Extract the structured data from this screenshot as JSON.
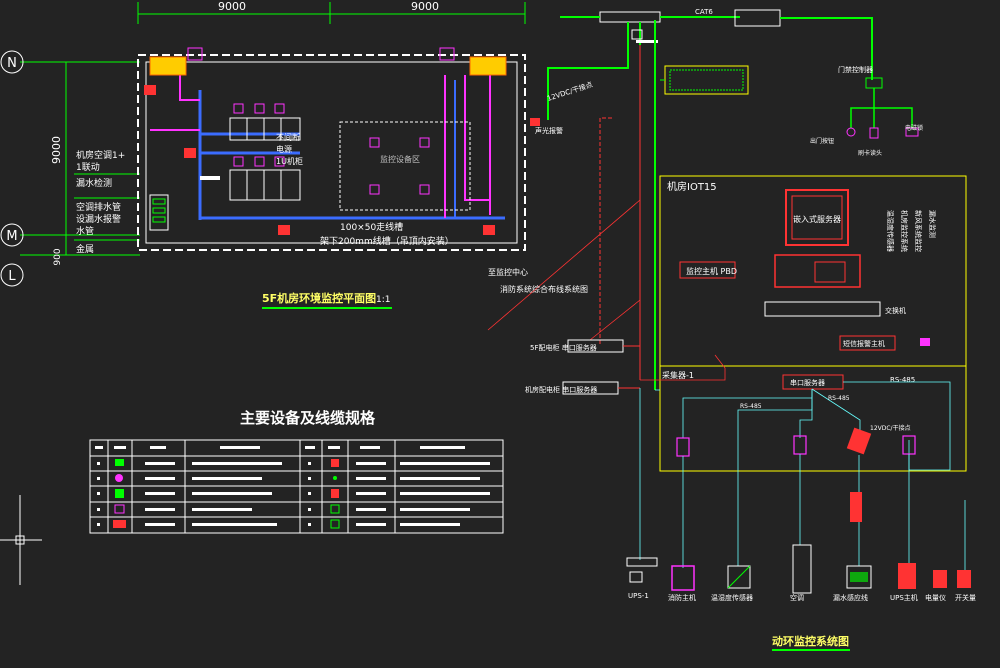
{
  "plan": {
    "dim_left": "9000",
    "dim_right": "9000",
    "dim_vertical": "9000",
    "dim_small": "900",
    "axis_n": "N",
    "axis_m": "M",
    "axis_l": "L",
    "notes": [
      "机房空调1+",
      "1联动",
      "漏水检测",
      "空调排水管",
      "设漏水报警",
      "水管",
      "金属"
    ],
    "rack_label_1": "不间断",
    "rack_label_2": "电源",
    "rack_label_3": "1U机柜",
    "tray_label": "100×50走线槽",
    "floor_label": "架下200mm线槽（吊顶内安装）",
    "zone_label": "监控设备区",
    "title": "5F机房环境监控平面图",
    "scale": "1:1"
  },
  "table": {
    "title": "主要设备及线缆规格",
    "rows": 5,
    "cols": 8
  },
  "system": {
    "title": "动环监控系统图",
    "cat6": "CAT6",
    "room_label": "机房IOT15",
    "server_label": "嵌入式服务器",
    "monitor_label": "监控主机 PBD",
    "switch_label": "交换机",
    "sms_label": "短信报警主机",
    "collector_label": "采集器-1",
    "serial_label": "串口服务器",
    "rs485_label": "RS-485",
    "rs485b": "RS-485",
    "rs485c": "RS-485",
    "dry_contact_left": "12VDC/干接点",
    "dry_contact_right": "12VDC/干接点",
    "alarm_label": "声光报警",
    "door_controller": "门禁控制器",
    "door_exit": "出门按钮",
    "door_lock": "电磁锁",
    "card_reader": "刷卡读头",
    "wiring_a": "至监控中心",
    "wiring_b": "消防系统综合布线系统图",
    "left_box1": "5F配电柜 串口服务器",
    "left_box2": "机房配电柜 串口服务器",
    "vertical_texts": [
      "温湿度传感器",
      "机房监控系统",
      "新风系统监控",
      "漏水监测"
    ],
    "bottom_devices": [
      "UPS-1",
      "消防主机",
      "温湿度传感器",
      "空调",
      "漏水感应线",
      "UPS主机",
      "电量仪",
      "开关量"
    ]
  }
}
